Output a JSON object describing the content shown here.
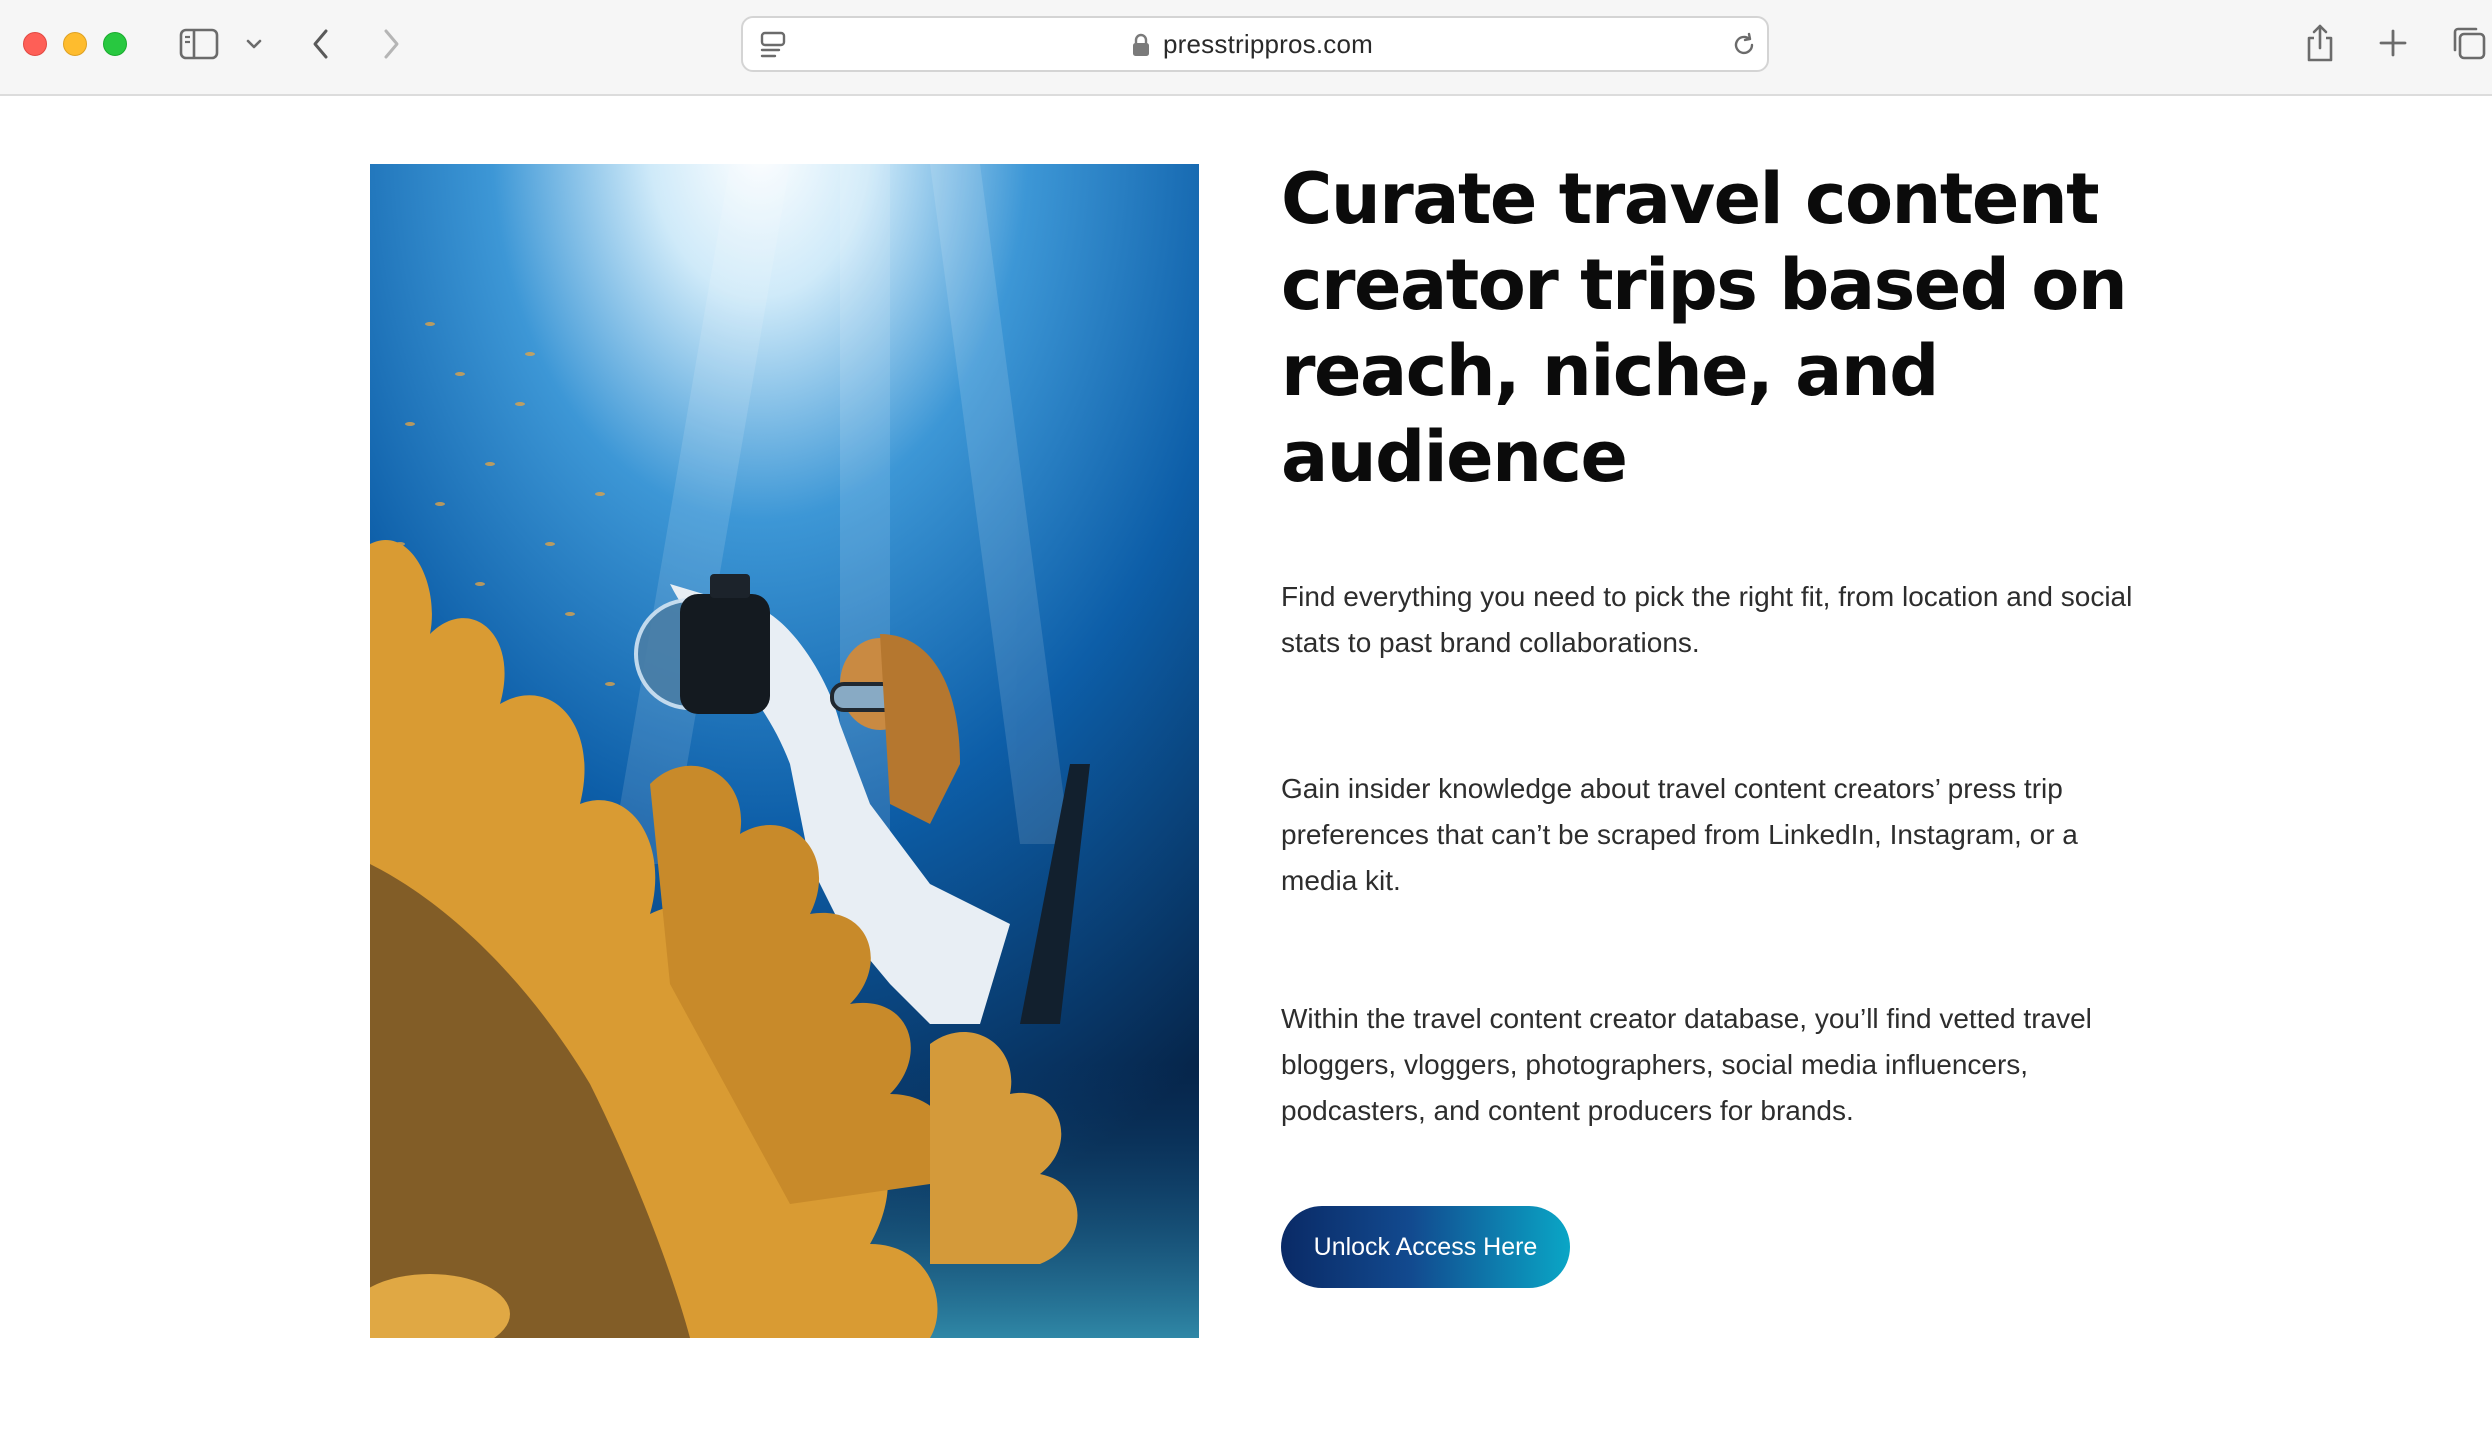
{
  "browser": {
    "url": "presstrippros.com",
    "icons": {
      "sidebar": "sidebar-icon",
      "sidebar_menu": "chevron-down-icon",
      "back": "chevron-left-icon",
      "forward": "chevron-right-icon",
      "page_menu": "page-menu-icon",
      "lock": "lock-icon",
      "reload": "reload-icon",
      "share": "share-icon",
      "new_tab": "plus-icon",
      "tabs_overview": "tabs-icon"
    }
  },
  "hero": {
    "headline": "Curate travel content creator trips based on reach, niche, and audience",
    "paragraphs": [
      "Find everything you need to pick the right fit, from location and social stats to past brand collaborations.",
      "Gain insider knowledge about travel content creators’ press trip preferences that can’t be scraped from LinkedIn, Instagram, or a media kit.",
      "Within the travel content creator database, you’ll find vetted travel bloggers, vloggers, photographers, social media influencers, podcasters, and content producers for brands."
    ],
    "cta_label": "Unlock Access Here",
    "colors": {
      "cta_start": "#0a2a66",
      "cta_end": "#0aa6c6",
      "headline": "#0b0b0b",
      "body_text": "#2d2d2d"
    }
  }
}
